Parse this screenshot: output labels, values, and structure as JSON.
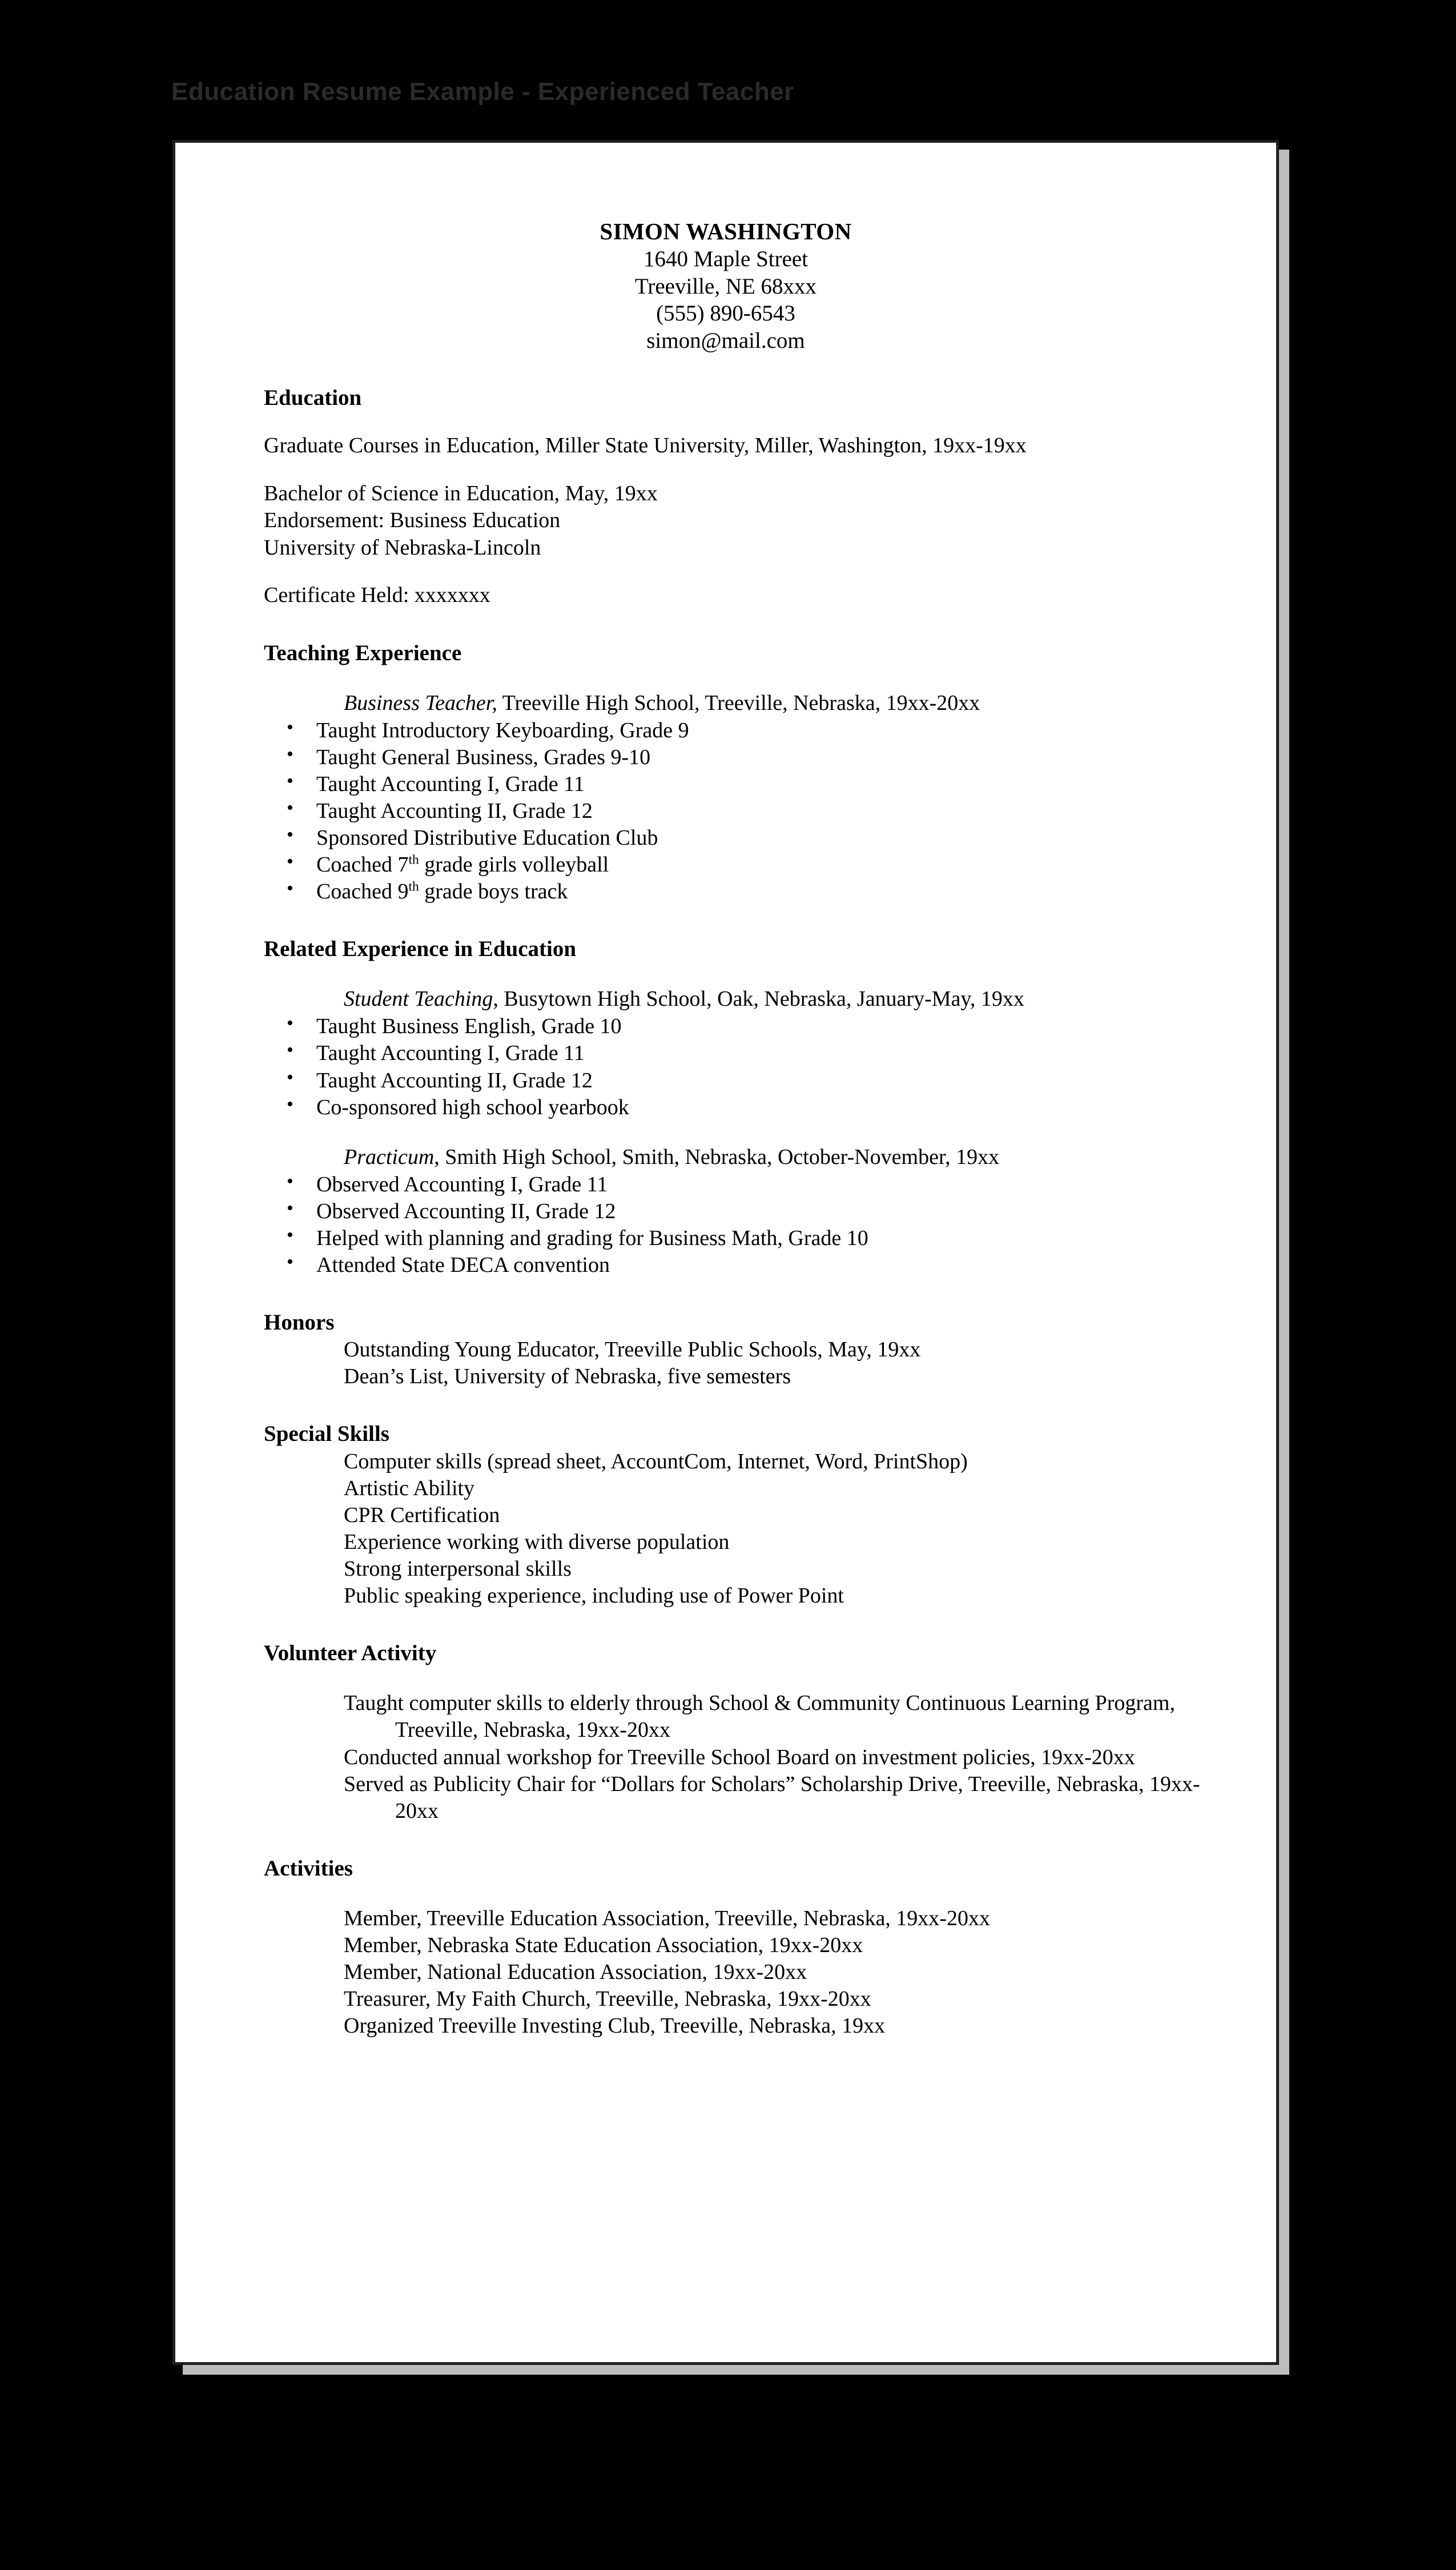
{
  "document_title": "Education Resume Example - Experienced Teacher",
  "colors": {
    "background": "#000000",
    "paper": "#ffffff",
    "paper_border": "#231f20",
    "paper_shadow": "#bdbdbd",
    "title_text": "#2b2b2b",
    "body_text": "#000000"
  },
  "header": {
    "name": "SIMON WASHINGTON",
    "street": "1640 Maple Street",
    "city_state_zip": "Treeville, NE  68xxx",
    "phone": "(555) 890-6543",
    "email": "simon@mail.com"
  },
  "sections": {
    "education": {
      "heading": "Education",
      "entries": [
        "Graduate Courses in Education, Miller State University, Miller, Washington, 19xx-19xx"
      ],
      "degree_lines": [
        "Bachelor of Science in Education, May, 19xx",
        "Endorsement: Business Education",
        "University of Nebraska-Lincoln"
      ],
      "certificate": "Certificate Held: xxxxxxx"
    },
    "teaching_experience": {
      "heading": "Teaching Experience",
      "role_italic": "Business Teacher,",
      "role_rest": " Treeville High School, Treeville, Nebraska, 19xx-20xx",
      "bullets": [
        "Taught Introductory Keyboarding, Grade 9",
        "Taught General Business, Grades 9-10",
        "Taught Accounting I, Grade 11",
        "Taught Accounting II, Grade 12",
        "Sponsored Distributive Education Club"
      ],
      "bullet_coach_volleyball_pre": "Coached 7",
      "bullet_coach_volleyball_sup": "th",
      "bullet_coach_volleyball_post": " grade girls volleyball",
      "bullet_coach_track_pre": "Coached 9",
      "bullet_coach_track_sup": "th",
      "bullet_coach_track_post": " grade boys track"
    },
    "related_experience": {
      "heading": "Related Experience in Education",
      "student_teaching": {
        "role_italic": "Student Teaching",
        "role_rest": ", Busytown High School, Oak, Nebraska, January-May, 19xx",
        "bullets": [
          "Taught Business English, Grade 10",
          "Taught Accounting I, Grade 11",
          "Taught Accounting II, Grade 12",
          "Co-sponsored high school yearbook"
        ]
      },
      "practicum": {
        "role_italic": "Practicum",
        "role_rest": ", Smith High School, Smith, Nebraska, October-November, 19xx",
        "bullets": [
          "Observed Accounting I, Grade 11",
          "Observed Accounting II, Grade 12",
          "Helped with planning and grading for Business Math, Grade 10",
          "Attended State DECA convention"
        ]
      }
    },
    "honors": {
      "heading": "Honors",
      "items": [
        "Outstanding Young Educator, Treeville Public Schools, May, 19xx",
        "Dean’s List, University of Nebraska, five semesters"
      ]
    },
    "special_skills": {
      "heading": "Special Skills",
      "items": [
        "Computer skills (spread sheet, AccountCom, Internet, Word, PrintShop)",
        "Artistic Ability",
        "CPR Certification",
        "Experience working with diverse population",
        "Strong interpersonal skills",
        "Public speaking experience, including use of Power Point"
      ]
    },
    "volunteer_activity": {
      "heading": "Volunteer Activity",
      "items": [
        "Taught computer skills to elderly through School & Community Continuous Learning Program, Treeville, Nebraska, 19xx-20xx",
        "Conducted annual workshop for Treeville School Board on investment policies, 19xx-20xx",
        "Served as Publicity Chair for “Dollars for Scholars” Scholarship Drive, Treeville, Nebraska, 19xx-20xx"
      ]
    },
    "activities": {
      "heading": "Activities",
      "items": [
        "Member, Treeville Education Association, Treeville, Nebraska, 19xx-20xx",
        "Member, Nebraska State Education Association, 19xx-20xx",
        "Member, National Education Association, 19xx-20xx",
        "Treasurer, My Faith Church, Treeville, Nebraska, 19xx-20xx",
        "Organized Treeville Investing Club, Treeville, Nebraska, 19xx"
      ]
    }
  }
}
